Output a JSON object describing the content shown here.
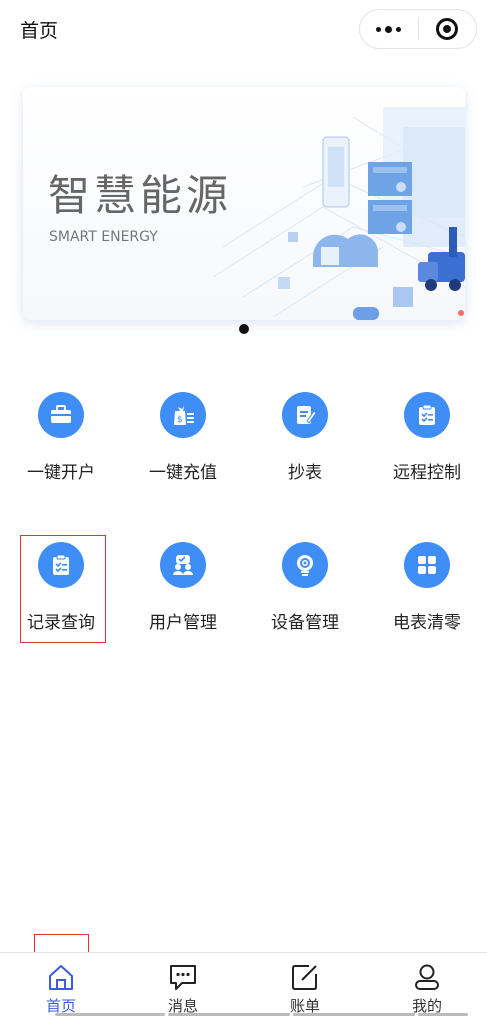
{
  "header": {
    "title": "首页"
  },
  "banner": {
    "title": "智慧能源",
    "subtitle": "SMART ENERGY",
    "slide_count": 1,
    "active_slide": 1
  },
  "grid": {
    "row1": [
      {
        "label": "一键开户",
        "icon": "briefcase-icon",
        "color": "#3f8ef5"
      },
      {
        "label": "一键充值",
        "icon": "money-bag-icon",
        "color": "#3f8ef5"
      },
      {
        "label": "抄表",
        "icon": "edit-document-icon",
        "color": "#3f8ef5"
      },
      {
        "label": "远程控制",
        "icon": "clipboard-check-icon",
        "color": "#3f8ef5"
      }
    ],
    "row2": [
      {
        "label": "记录查询",
        "icon": "clipboard-list-icon",
        "color": "#3f8ef5"
      },
      {
        "label": "用户管理",
        "icon": "users-icon",
        "color": "#3f8ef5"
      },
      {
        "label": "设备管理",
        "icon": "gear-bulb-icon",
        "color": "#3f8ef5"
      },
      {
        "label": "电表清零",
        "icon": "grid-icon",
        "color": "#3f8ef5"
      }
    ]
  },
  "tabbar": {
    "items": [
      {
        "label": "首页",
        "icon": "home-icon",
        "active": true
      },
      {
        "label": "消息",
        "icon": "message-icon",
        "active": false
      },
      {
        "label": "账单",
        "icon": "edit-icon",
        "active": false
      },
      {
        "label": "我的",
        "icon": "user-icon",
        "active": false
      }
    ]
  },
  "colors": {
    "accent": "#3a5de0",
    "icon_blue": "#3f8ef5",
    "highlight": "#e0322f"
  }
}
